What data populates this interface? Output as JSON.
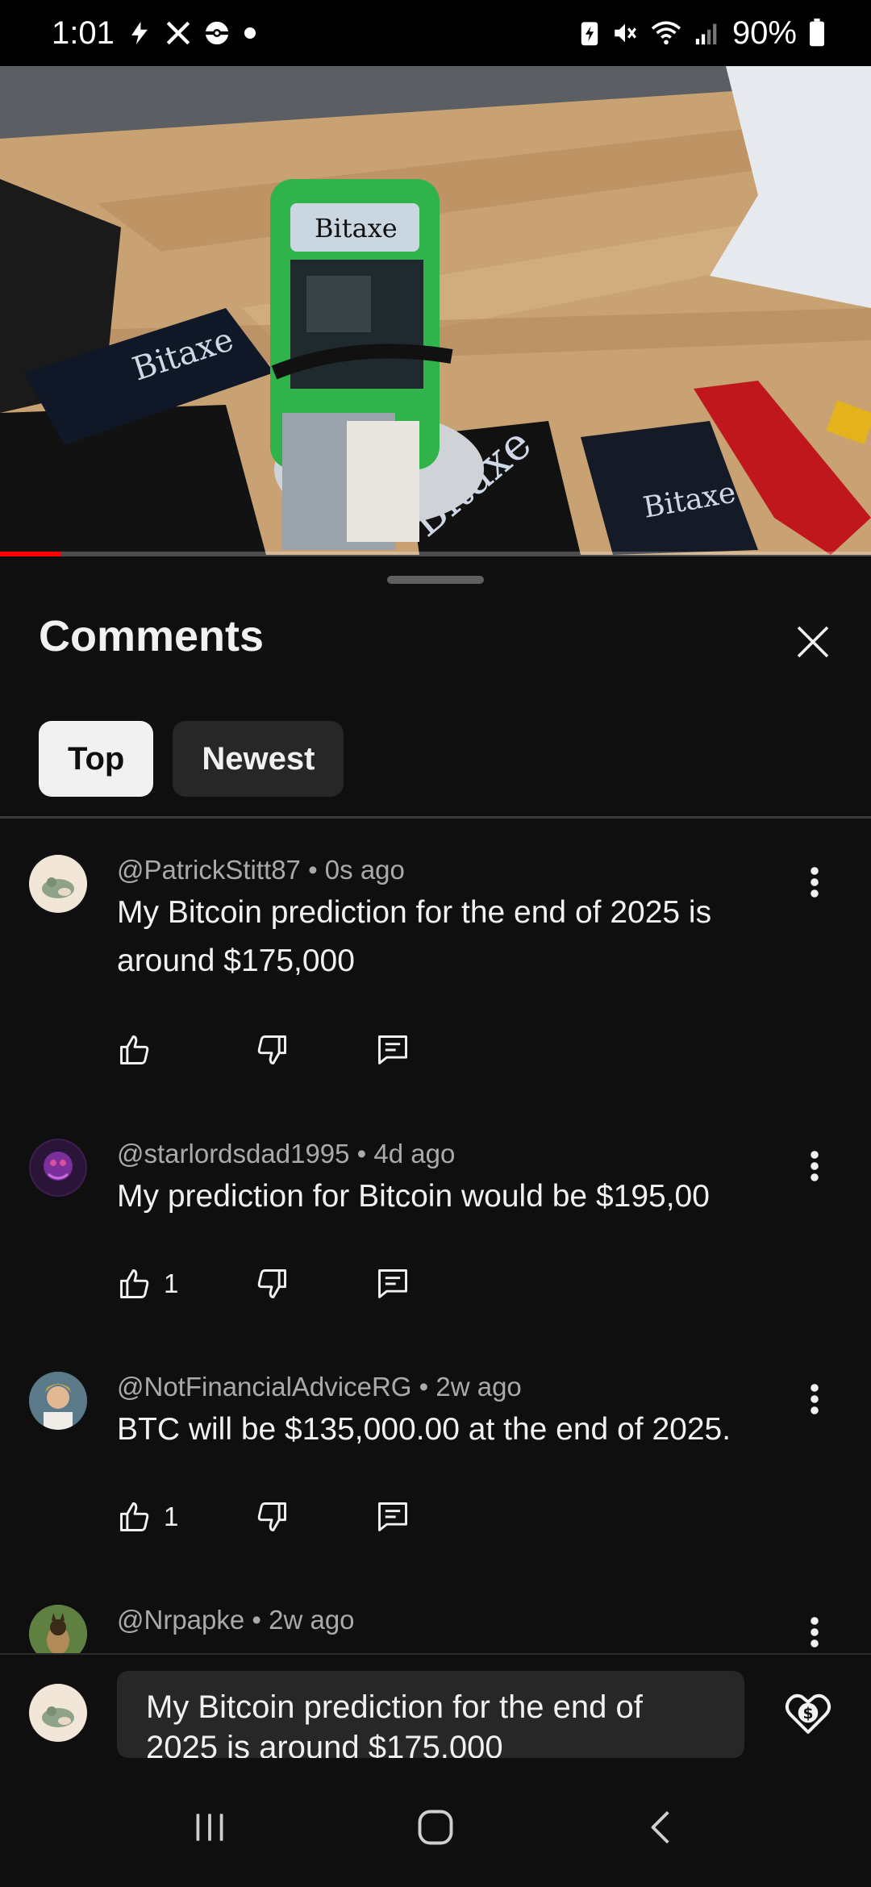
{
  "status_bar": {
    "time": "1:01",
    "battery": "90%",
    "left_icons": [
      "flash-icon",
      "x-app-icon",
      "pokeball-icon",
      "dot-icon"
    ],
    "right_icons": [
      "battery-saver-icon",
      "mute-icon",
      "wifi-icon",
      "signal-icon",
      "battery-icon"
    ]
  },
  "video": {
    "progress_fraction": 0.07,
    "scene_text": [
      "Bitaxe",
      "Bitaxe",
      "Bitaxe"
    ]
  },
  "sheet": {
    "title": "Comments",
    "close_icon": "close-icon",
    "tabs": [
      {
        "label": "Top",
        "active": true
      },
      {
        "label": "Newest",
        "active": false
      }
    ]
  },
  "comments": [
    {
      "author": "@PatrickStitt87",
      "age": "0s ago",
      "text": "My Bitcoin prediction for the end of 2025 is around $175,000",
      "likes": ""
    },
    {
      "author": "@starlordsdad1995",
      "age": "4d ago",
      "text": "My prediction for Bitcoin would be $195,00",
      "likes": "1"
    },
    {
      "author": "@NotFinancialAdviceRG",
      "age": "2w ago",
      "text": "BTC will be $135,000.00 at the end of 2025.",
      "likes": "1"
    },
    {
      "author": "@Nrpapke",
      "age": "2w ago",
      "text": "",
      "likes": ""
    }
  ],
  "separator": " • ",
  "composer": {
    "value": "My Bitcoin prediction for the end of 2025 is around $175,000",
    "thanks_icon": "super-thanks-icon"
  },
  "navbar": {
    "icons": [
      "recent-apps-icon",
      "home-icon",
      "back-icon"
    ]
  },
  "colors": {
    "background": "#0f0f0f",
    "chip_active": "#f1f1f1",
    "chip_inactive": "#272727",
    "meta_text": "#aaaaaa",
    "progress": "#ff0000"
  }
}
